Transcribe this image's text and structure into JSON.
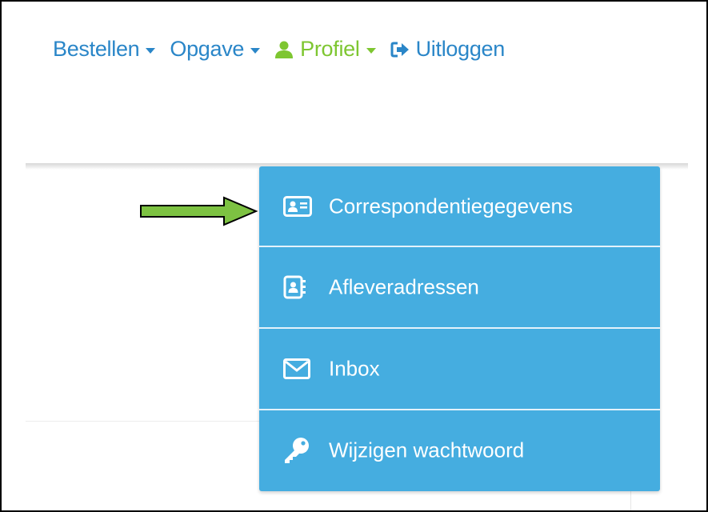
{
  "nav": {
    "bestellen": "Bestellen",
    "opgave": "Opgave",
    "profiel": "Profiel",
    "uitloggen": "Uitloggen"
  },
  "dropdown": {
    "items": [
      {
        "label": "Correspondentiegegevens",
        "icon": "id-card-icon"
      },
      {
        "label": "Afleveradressen",
        "icon": "address-book-icon"
      },
      {
        "label": "Inbox",
        "icon": "envelope-icon"
      },
      {
        "label": "Wijzigen wachtwoord",
        "icon": "key-icon"
      }
    ]
  },
  "colors": {
    "link": "#2a86c8",
    "active": "#7ec631",
    "menu_bg": "#45ade0",
    "arrow": "#7dc242"
  }
}
